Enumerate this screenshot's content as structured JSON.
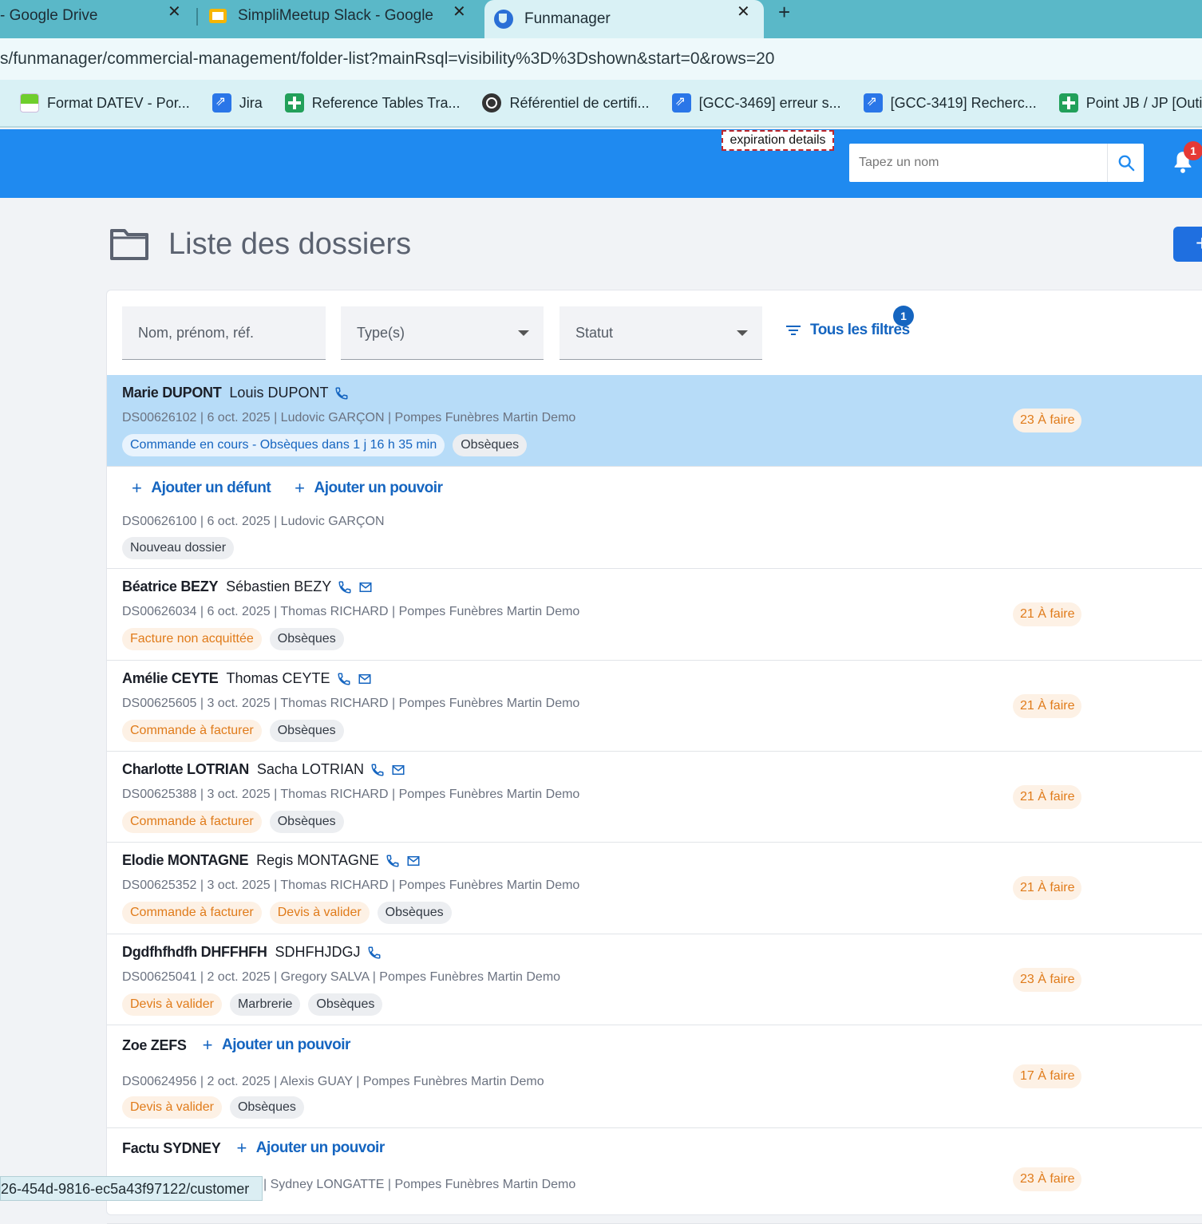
{
  "browser": {
    "tabs": [
      {
        "title": "- Google Drive"
      },
      {
        "title": "SimpliMeetup Slack - Google Sl"
      },
      {
        "title": "Funmanager"
      }
    ],
    "new_tab": "+",
    "close_glyph": "✕",
    "url": "s/funmanager/commercial-management/folder-list?mainRsql=visibility%3D%3Dshown&start=0&rows=20",
    "bookmarks": [
      {
        "label": "Format DATEV - Por...",
        "icon": "datev-icon"
      },
      {
        "label": "Jira",
        "icon": "jira-icon"
      },
      {
        "label": "Reference Tables Tra...",
        "icon": "plus-doc-icon"
      },
      {
        "label": "Référentiel de certifi...",
        "icon": "globe-icon"
      },
      {
        "label": "[GCC-3469] erreur s...",
        "icon": "jira-icon"
      },
      {
        "label": "[GCC-3419] Recherc...",
        "icon": "jira-icon"
      },
      {
        "label": "Point JB / JP [Outils...",
        "icon": "plus-doc-icon"
      }
    ],
    "status_url": "26-454d-9816-ec5a43f97122/customer"
  },
  "header": {
    "tooltip": "expiration details",
    "search_placeholder": "Tapez un nom",
    "notification_count": "1"
  },
  "page": {
    "title": "Liste des dossiers",
    "fab_label": "+"
  },
  "filters": {
    "name_placeholder": "Nom, prénom, réf.",
    "type_label": "Type(s)",
    "status_label": "Statut",
    "all_filters_label": "Tous les filtres",
    "active_count": "1"
  },
  "actions": {
    "add_deceased": "Ajouter un défunt",
    "add_power": "Ajouter un pouvoir"
  },
  "folders": [
    {
      "deceased": "Marie DUPONT",
      "contact": "Louis DUPONT",
      "phone": true,
      "mail": false,
      "meta": "DS00626102 | 6 oct. 2025 | Ludovic GARÇON | Pompes Funèbres Martin Demo",
      "tags": [
        {
          "label": "Commande en cours - Obsèques dans 1 j 16 h 35 min",
          "style": "blue"
        },
        {
          "label": "Obsèques",
          "style": "grey"
        }
      ],
      "todo": "23 À faire",
      "selected": true
    },
    {
      "deceased": "",
      "contact": "",
      "phone": false,
      "mail": false,
      "actions": [
        "add_deceased",
        "add_power"
      ],
      "meta": "DS00626100 | 6 oct. 2025 | Ludovic GARÇON",
      "tags": [
        {
          "label": "Nouveau dossier",
          "style": "grey"
        }
      ],
      "todo": ""
    },
    {
      "deceased": "Béatrice BEZY",
      "contact": "Sébastien BEZY",
      "phone": true,
      "mail": true,
      "meta": "DS00626034 | 6 oct. 2025 | Thomas RICHARD | Pompes Funèbres Martin Demo",
      "tags": [
        {
          "label": "Facture non acquittée",
          "style": "orange"
        },
        {
          "label": "Obsèques",
          "style": "grey"
        }
      ],
      "todo": "21 À faire"
    },
    {
      "deceased": "Amélie CEYTE",
      "contact": "Thomas CEYTE",
      "phone": true,
      "mail": true,
      "meta": "DS00625605 | 3 oct. 2025 | Thomas RICHARD | Pompes Funèbres Martin Demo",
      "tags": [
        {
          "label": "Commande à facturer",
          "style": "orange"
        },
        {
          "label": "Obsèques",
          "style": "grey"
        }
      ],
      "todo": "21 À faire"
    },
    {
      "deceased": "Charlotte LOTRIAN",
      "contact": "Sacha LOTRIAN",
      "phone": true,
      "mail": true,
      "meta": "DS00625388 | 3 oct. 2025 | Thomas RICHARD | Pompes Funèbres Martin Demo",
      "tags": [
        {
          "label": "Commande à facturer",
          "style": "orange"
        },
        {
          "label": "Obsèques",
          "style": "grey"
        }
      ],
      "todo": "21 À faire"
    },
    {
      "deceased": "Elodie MONTAGNE",
      "contact": "Regis MONTAGNE",
      "phone": true,
      "mail": true,
      "meta": "DS00625352 | 3 oct. 2025 | Thomas RICHARD | Pompes Funèbres Martin Demo",
      "tags": [
        {
          "label": "Commande à facturer",
          "style": "orange"
        },
        {
          "label": "Devis à valider",
          "style": "orange"
        },
        {
          "label": "Obsèques",
          "style": "grey"
        }
      ],
      "todo": "21 À faire"
    },
    {
      "deceased": "Dgdfhfhdfh DHFFHFH",
      "contact": "SDHFHJDGJ",
      "phone": true,
      "mail": false,
      "meta": "DS00625041 | 2 oct. 2025 | Gregory SALVA | Pompes Funèbres Martin Demo",
      "tags": [
        {
          "label": "Devis à valider",
          "style": "orange"
        },
        {
          "label": "Marbrerie",
          "style": "grey"
        },
        {
          "label": "Obsèques",
          "style": "grey"
        }
      ],
      "todo": "23 À faire"
    },
    {
      "deceased": "Zoe ZEFS",
      "contact": "",
      "phone": false,
      "mail": false,
      "actions": [
        "add_power"
      ],
      "meta": "DS00624956 | 2 oct. 2025 | Alexis GUAY | Pompes Funèbres Martin Demo",
      "tags": [
        {
          "label": "Devis à valider",
          "style": "orange"
        },
        {
          "label": "Obsèques",
          "style": "grey"
        }
      ],
      "todo": "17 À faire"
    },
    {
      "deceased": "Factu SYDNEY",
      "contact": "",
      "phone": false,
      "mail": false,
      "actions": [
        "add_power"
      ],
      "meta": "| Sydney LONGATTE | Pompes Funèbres Martin Demo",
      "tags": [],
      "todo": "23 À faire"
    }
  ],
  "colors": {
    "app_header": "#1f8af0",
    "primary": "#1565c0",
    "selected_row": "#b7dcf8",
    "orange_badge": "#e07b1a",
    "notification": "#e53935"
  }
}
